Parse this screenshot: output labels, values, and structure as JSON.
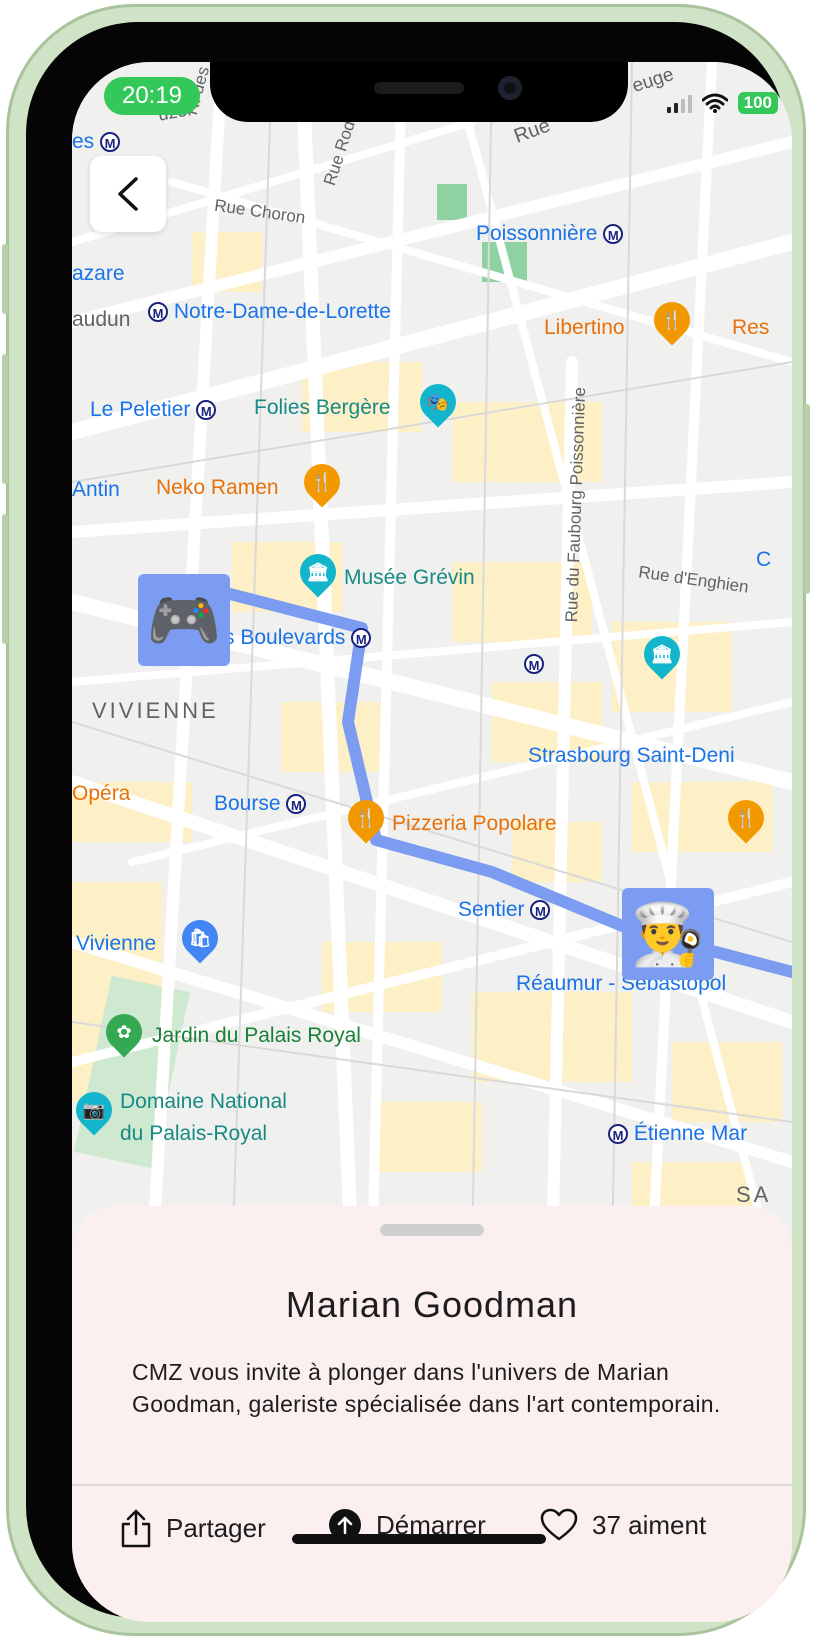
{
  "status_bar": {
    "time": "20:19",
    "battery": "100"
  },
  "map": {
    "streets": [
      "Rue Choron",
      "R. des Martyrs",
      "Rue Rodier",
      "Rue du Faubourg Poissonnière",
      "Rue d'Enghien",
      "Rue"
    ],
    "metro_stations": [
      "Poissonnière",
      "Notre-Dame-de-Lorette",
      "Le Peletier",
      "s Boulevards",
      "Bourse",
      "Sentier",
      "Réaumur - Sébastopol",
      "Strasbourg Saint-Deni",
      "Étienne Mar",
      "es"
    ],
    "places": {
      "libertino": "Libertino",
      "res": "Res",
      "folies": "Folies Bergère",
      "neko": "Neko Ramen",
      "grevin": "Musée Grévin",
      "pizzeria": "Pizzeria Popolare",
      "vivienne_shop": "Vivienne",
      "jardin": "Jardin du Palais Royal",
      "domaine_1": "Domaine National",
      "domaine_2": "du Palais-Royal"
    },
    "districts": [
      "VIVIENNE",
      "SA"
    ],
    "partials": [
      "azare",
      "audun",
      "Antin",
      "Opéra",
      "euge",
      "uzel",
      "Rue",
      "C"
    ]
  },
  "sheet": {
    "title": "Marian Goodman",
    "description": "CMZ vous invite à plonger dans l'univers de Marian Goodman, galeriste spécialisée dans l'art contemporain.",
    "share_label": "Partager",
    "start_label": "Démarrer",
    "likes_label": "37 aiment"
  },
  "colors": {
    "route": "#7b9cf0",
    "sheet_bg": "#fcefef",
    "frame": "#cfe3c6"
  },
  "icons": [
    "back-chevron-icon",
    "gamepad-icon",
    "chef-icon",
    "share-icon",
    "arrow-up-icon",
    "heart-icon",
    "restaurant-icon",
    "museum-icon",
    "theater-icon",
    "shopping-icon",
    "flower-icon",
    "camera-icon"
  ]
}
